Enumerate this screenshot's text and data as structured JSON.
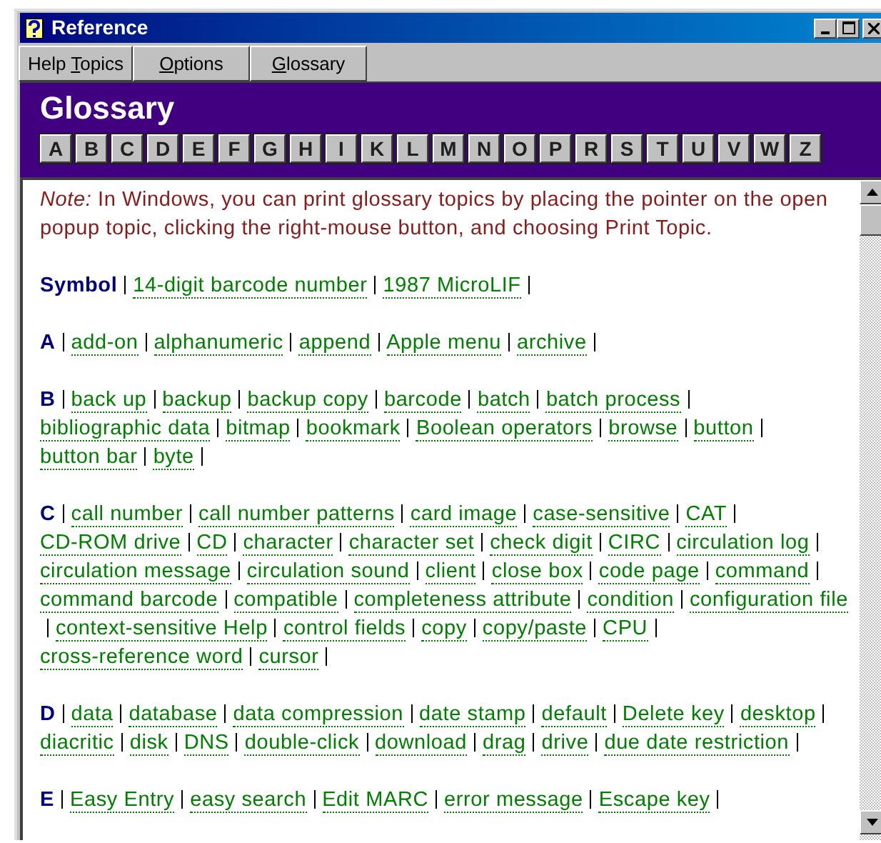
{
  "window": {
    "title": "Reference"
  },
  "toolbar": {
    "buttons": [
      {
        "before": "Help ",
        "key": "T",
        "after": "opics"
      },
      {
        "key": "O",
        "after": "ptions"
      },
      {
        "key": "G",
        "after": "lossary"
      }
    ]
  },
  "header": {
    "title": "Glossary",
    "letters": [
      "A",
      "B",
      "C",
      "D",
      "E",
      "F",
      "G",
      "H",
      "I",
      "K",
      "L",
      "M",
      "N",
      "O",
      "P",
      "R",
      "S",
      "T",
      "U",
      "V",
      "W",
      "Z"
    ]
  },
  "note": "*Note:* In Windows, you can print glossary topics by placing the pointer on the open popup topic, clicking the right-mouse button, and choosing Print Topic.",
  "sections": [
    {
      "heading": "Symbol",
      "terms": [
        "14-digit barcode number",
        "1987 MicroLIF"
      ]
    },
    {
      "heading": "A",
      "terms": [
        "add-on",
        "alphanumeric",
        "append",
        "Apple menu",
        "archive"
      ]
    },
    {
      "heading": "B",
      "terms": [
        "back up",
        "backup",
        "backup copy",
        "barcode",
        "batch",
        "batch process",
        "bibliographic data",
        "bitmap",
        "bookmark",
        "Boolean operators",
        "browse",
        "button",
        "button bar",
        "byte"
      ]
    },
    {
      "heading": "C",
      "terms": [
        "call number",
        "call number patterns",
        "card image",
        "case-sensitive",
        "CAT",
        "CD-ROM drive",
        "CD",
        "character",
        "character set",
        "check digit",
        "CIRC",
        "circulation log",
        "circulation message",
        "circulation sound",
        "client",
        "close box",
        "code page",
        "command",
        "command barcode",
        "compatible",
        "completeness attribute",
        "condition",
        "configuration file",
        "context-sensitive Help",
        "control fields",
        "copy",
        "copy/paste",
        "CPU",
        "cross-reference word",
        "cursor"
      ]
    },
    {
      "heading": "D",
      "terms": [
        "data",
        "database",
        "data compression",
        "date stamp",
        "default",
        "Delete key",
        "desktop",
        "diacritic",
        "disk",
        "DNS",
        "double-click",
        "download",
        "drag",
        "drive",
        "due date restriction"
      ]
    },
    {
      "heading": "E",
      "terms": [
        "Easy Entry",
        "easy search",
        "Edit MARC",
        "error message",
        "Escape key"
      ]
    }
  ]
}
